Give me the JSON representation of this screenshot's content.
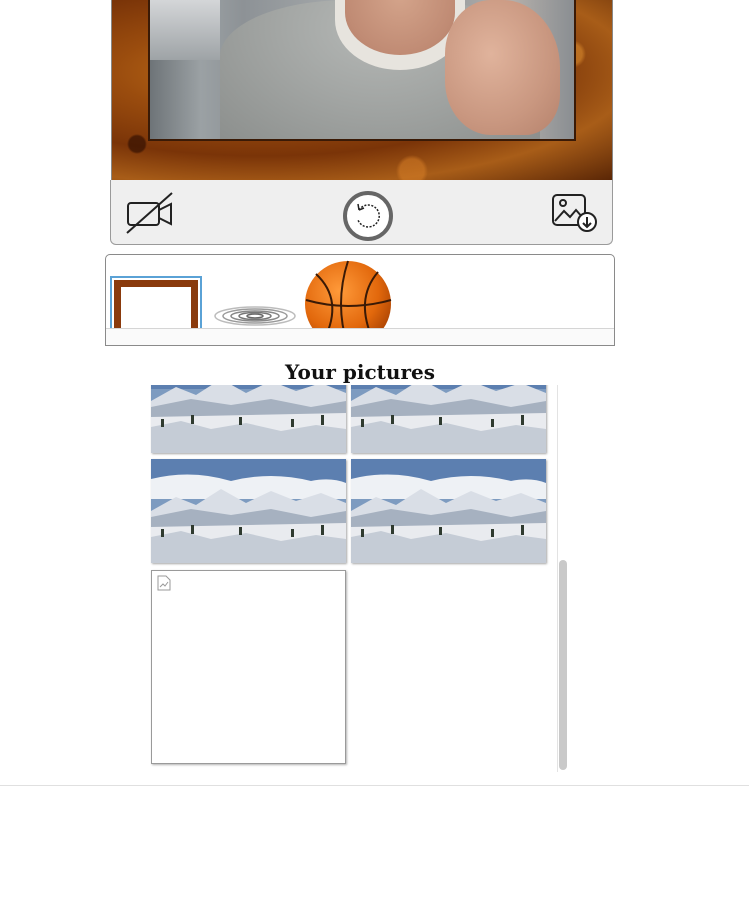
{
  "camera": {
    "controls": {
      "camera_off_icon": "camera-off-icon",
      "reset_icon": "rotate-ccw-icon",
      "save_icon": "image-download-icon"
    }
  },
  "overlay_strip": {
    "items": [
      {
        "name": "wood-frame",
        "selected": true
      },
      {
        "name": "water-ripple",
        "selected": false
      },
      {
        "name": "basketball",
        "selected": false
      }
    ]
  },
  "pictures": {
    "title": "Your pictures",
    "items": [
      {
        "kind": "winter-landscape"
      },
      {
        "kind": "winter-landscape"
      },
      {
        "kind": "winter-landscape"
      },
      {
        "kind": "winter-landscape"
      },
      {
        "kind": "broken-image"
      }
    ]
  },
  "colors": {
    "selection": "#5aa2d6",
    "frame_wood": "#8a3a0c"
  }
}
